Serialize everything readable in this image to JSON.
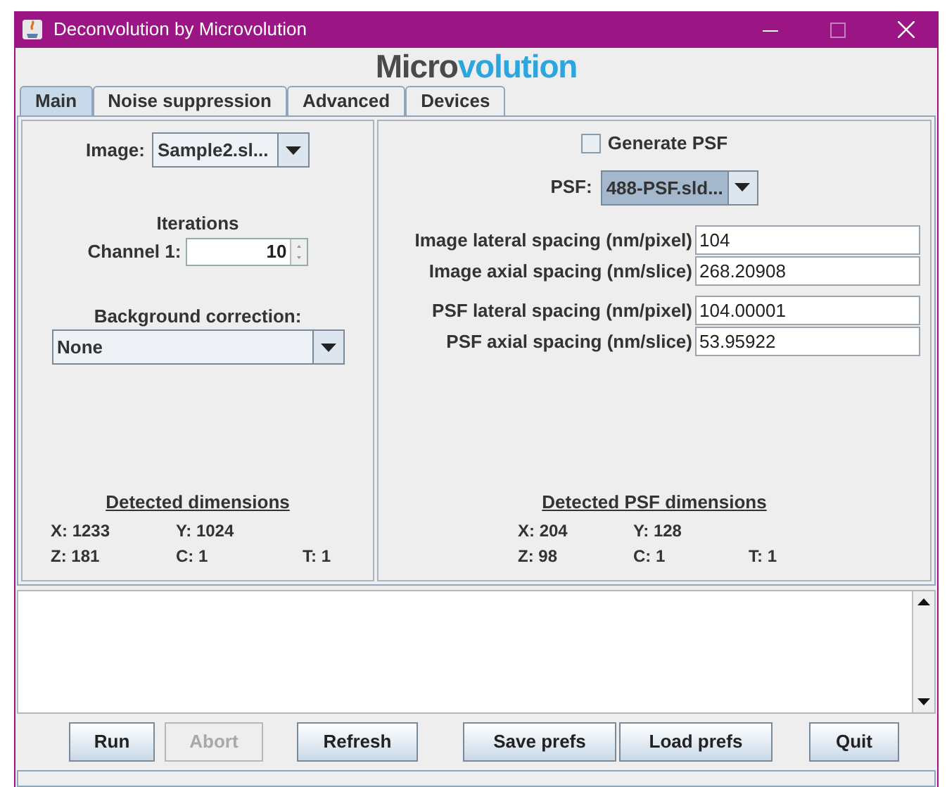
{
  "window": {
    "title": "Deconvolution by Microvolution"
  },
  "logo": {
    "part_1": "Micro",
    "part_2": "volution"
  },
  "tabs": [
    {
      "label": "Main",
      "selected": true
    },
    {
      "label": "Noise suppression",
      "selected": false
    },
    {
      "label": "Advanced",
      "selected": false
    },
    {
      "label": "Devices",
      "selected": false
    }
  ],
  "left": {
    "image_label": "Image:",
    "image_value": "Sample2.sl...",
    "iterations_label": "Iterations",
    "channel_label": "Channel 1:",
    "channel_value": "10",
    "background_label": "Background correction:",
    "background_value": "None",
    "dimensions": {
      "title": "Detected dimensions",
      "rows": [
        [
          "X: 1233",
          "Y: 1024"
        ],
        [
          "Z: 181",
          "C: 1",
          "T: 1"
        ]
      ]
    }
  },
  "right": {
    "generate_psf": {
      "label": "Generate PSF",
      "checked": false
    },
    "psf_label": "PSF:",
    "psf_value": "488-PSF.sld...",
    "psf_focused": true,
    "fields": [
      {
        "label": "Image lateral spacing (nm/pixel)",
        "value": "104"
      },
      {
        "label": "Image axial spacing (nm/slice)",
        "value": "268.20908"
      },
      {
        "label": "PSF lateral spacing (nm/pixel)",
        "value": "104.00001"
      },
      {
        "label": "PSF axial spacing (nm/slice)",
        "value": "53.95922"
      }
    ],
    "dimensions": {
      "title": "Detected PSF dimensions",
      "rows": [
        [
          "X: 204",
          "Y: 128"
        ],
        [
          "Z: 98",
          "C: 1",
          "T: 1"
        ]
      ]
    }
  },
  "buttons": [
    {
      "label": "Run",
      "disabled": false
    },
    {
      "label": "Abort",
      "disabled": true
    },
    {
      "label": "Refresh",
      "disabled": false
    },
    {
      "label": "Save prefs",
      "disabled": false
    },
    {
      "label": "Load prefs",
      "disabled": false
    },
    {
      "label": "Quit",
      "disabled": false
    }
  ]
}
